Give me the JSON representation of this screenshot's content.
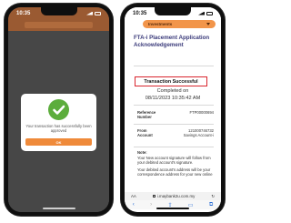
{
  "left_phone": {
    "status_time": "10:35",
    "dialog": {
      "message": "Your transaction has successfully been approved",
      "button_label": "OK"
    }
  },
  "right_phone": {
    "status_time": "10:35",
    "nav": {
      "label": "Investments"
    },
    "title": "FTA-i Placement Application Acknowledgement",
    "status": "Transaction Successful",
    "completed_label": "Completed on",
    "completed_datetime": "08/11/2023 10:35:42 AM",
    "details": [
      {
        "label": "Reference Number",
        "value": "FTP00000694"
      },
      {
        "label": "From Account",
        "value": "121000746732 Savings Account-i"
      }
    ],
    "note": {
      "title": "Note:",
      "lines": [
        "Your New account signature will follow from your debited account's signature.",
        "Your debited account's address will be your correspondence address for your new online"
      ]
    },
    "browser": {
      "aa": "AA",
      "url": "i.maybank2u.com.my"
    }
  },
  "colors": {
    "brand_orange": "#ef8a3a",
    "header_brown": "#9a5a32",
    "success_green": "#5cad3c",
    "highlight_red": "#d9262e",
    "title_blue": "#3a3a7a"
  },
  "icons": [
    "check-icon",
    "chevron-down-icon",
    "lock-icon",
    "reload-icon",
    "back-icon",
    "forward-icon",
    "share-icon",
    "book-icon",
    "tabs-icon"
  ]
}
